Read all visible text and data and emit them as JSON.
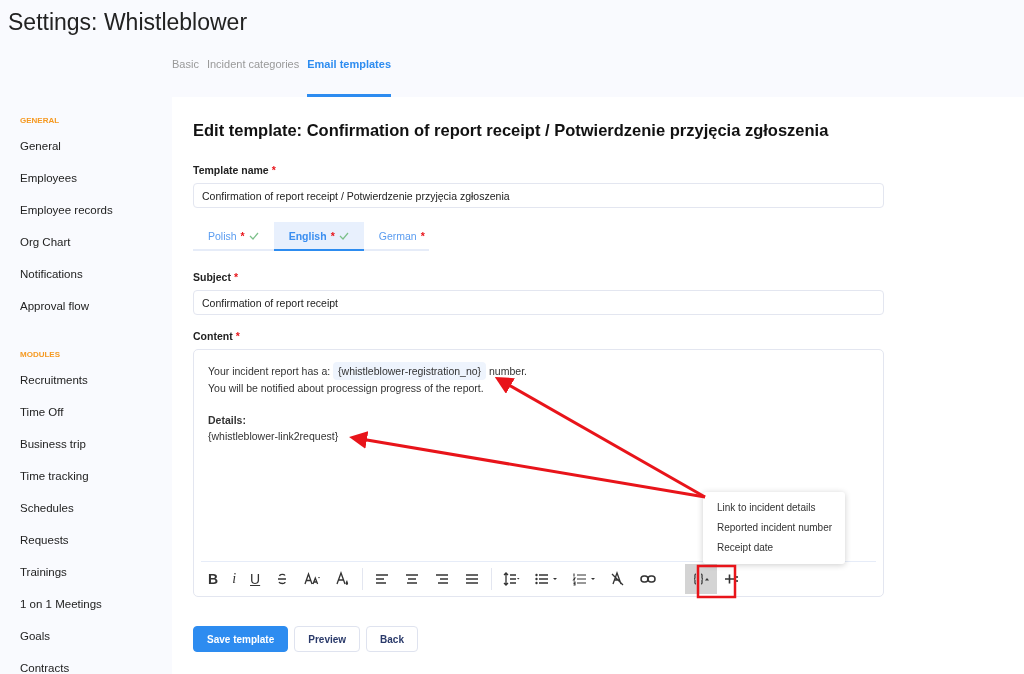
{
  "page_title": "Settings: Whistleblower",
  "top_tabs": [
    {
      "label": "Basic",
      "selected": false
    },
    {
      "label": "Incident categories",
      "selected": false
    },
    {
      "label": "Email templates",
      "selected": true
    }
  ],
  "sidebar": {
    "sections": [
      {
        "heading": "GENERAL",
        "items": [
          "General",
          "Employees",
          "Employee records",
          "Org Chart",
          "Notifications",
          "Approval flow"
        ]
      },
      {
        "heading": "MODULES",
        "items": [
          "Recruitments",
          "Time Off",
          "Business trip",
          "Time tracking",
          "Schedules",
          "Requests",
          "Trainings",
          "1 on 1 Meetings",
          "Goals",
          "Contracts"
        ]
      }
    ]
  },
  "heading": "Edit template: Confirmation of report receipt / Potwierdzenie przyjęcia zgłoszenia",
  "template_name": {
    "label": "Template name",
    "required_mark": "*",
    "value": "Confirmation of report receipt / Potwierdzenie przyjęcia zgłoszenia"
  },
  "language_tabs": [
    {
      "label": "Polish",
      "required_mark": "*",
      "done": true,
      "selected": false
    },
    {
      "label": "English",
      "required_mark": "*",
      "done": true,
      "selected": true
    },
    {
      "label": "German",
      "required_mark": "*",
      "done": false,
      "selected": false
    }
  ],
  "subject": {
    "label": "Subject",
    "required_mark": "*",
    "value": "Confirmation of report receipt"
  },
  "content": {
    "label": "Content",
    "required_mark": "*",
    "paragraphs": [
      [
        [
          {
            "kind": "text",
            "text": "Your incident report has a: "
          },
          {
            "kind": "chip",
            "text": "{whistleblower-registration_no}"
          },
          {
            "kind": "text",
            "text": " number."
          }
        ],
        [
          {
            "kind": "text",
            "text": "You will be notified about processign progress of the report."
          }
        ]
      ],
      [
        [
          {
            "kind": "bold",
            "text": "Details:"
          }
        ],
        [
          {
            "kind": "text",
            "text": "{whistleblower-link2request}"
          }
        ]
      ]
    ]
  },
  "toolbar": [
    {
      "kind": "bold",
      "label": "B",
      "selected": false
    },
    {
      "kind": "italic",
      "label": "i",
      "selected": false
    },
    {
      "kind": "underline",
      "label": "U",
      "selected": false
    },
    {
      "kind": "strike",
      "selected": false
    },
    {
      "kind": "fontsize",
      "selected": false
    },
    {
      "kind": "color",
      "selected": false
    },
    {
      "kind": "divider"
    },
    {
      "kind": "align-left",
      "selected": false
    },
    {
      "kind": "align-center",
      "selected": false
    },
    {
      "kind": "align-right",
      "selected": false
    },
    {
      "kind": "justify",
      "selected": false
    },
    {
      "kind": "divider"
    },
    {
      "kind": "line-height",
      "selected": false
    },
    {
      "kind": "bullets",
      "selected": false
    },
    {
      "kind": "numbers",
      "selected": false
    },
    {
      "kind": "clear",
      "selected": false
    },
    {
      "kind": "link",
      "selected": false
    },
    {
      "kind": "gap"
    },
    {
      "kind": "variables",
      "selected": true
    },
    {
      "kind": "insert",
      "selected": false
    }
  ],
  "variables_menu": [
    "Link to incident details",
    "Reported incident number",
    "Receipt date"
  ],
  "buttons": [
    {
      "kind": "primary",
      "label": "Save template"
    },
    {
      "kind": "secondary",
      "label": "Preview"
    },
    {
      "kind": "secondary",
      "label": "Back"
    }
  ]
}
